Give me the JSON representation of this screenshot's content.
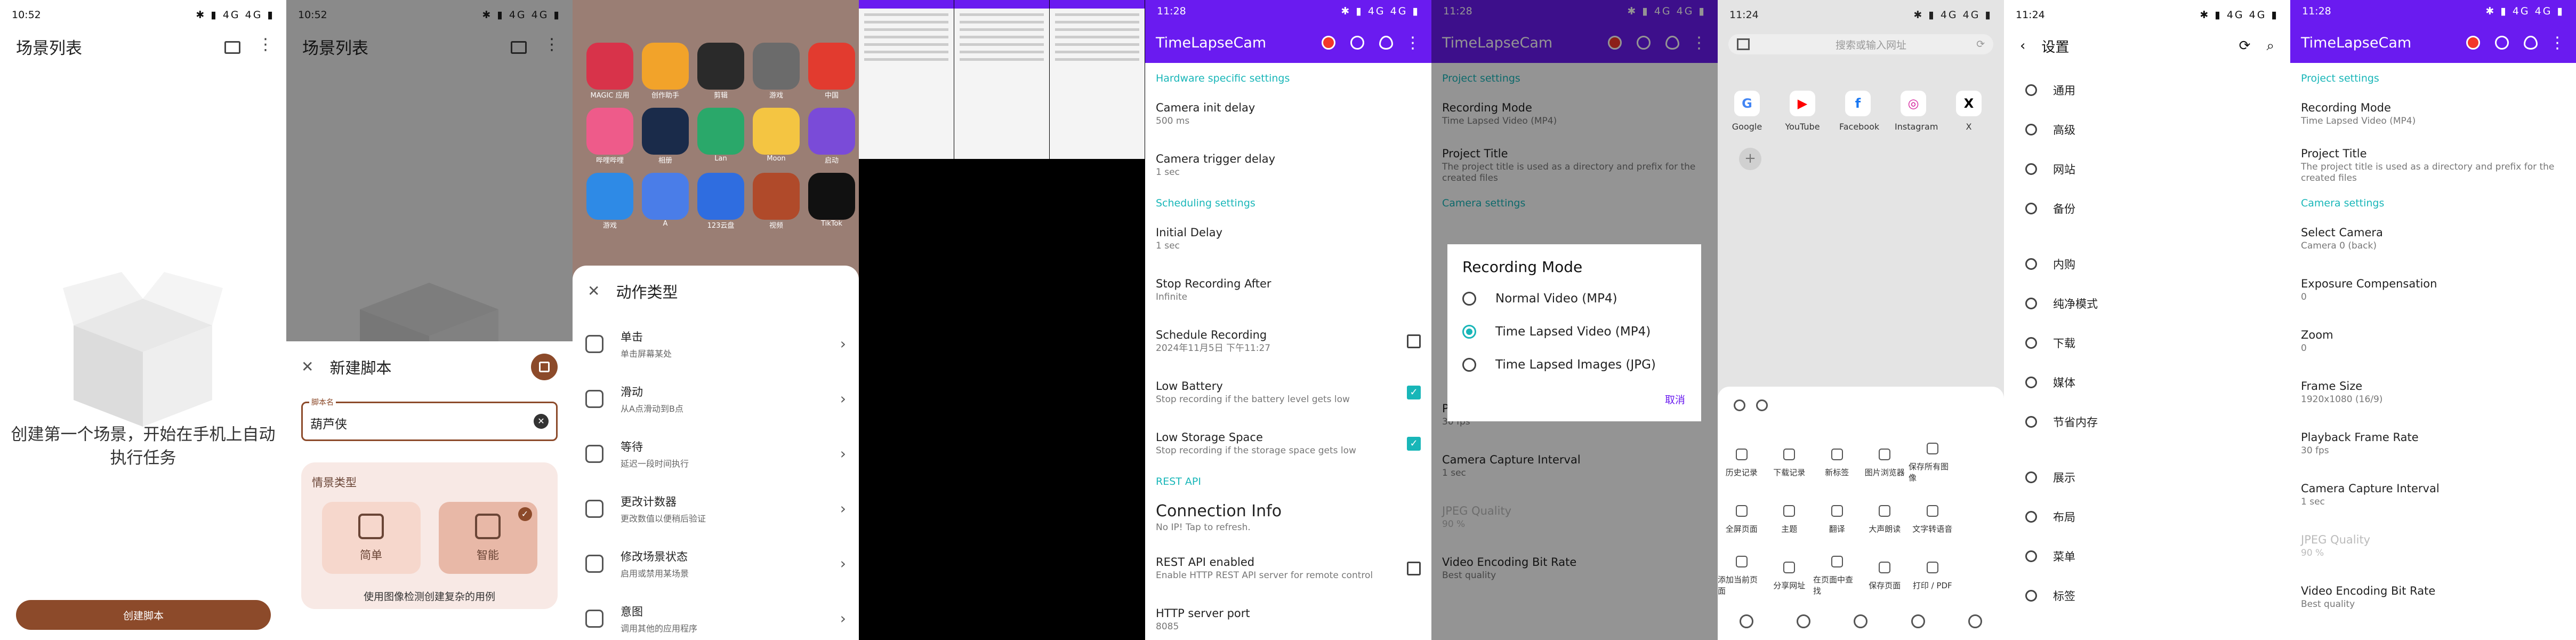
{
  "panel1": {
    "time": "10:52",
    "status_icons": "✱ ▮ 4G 4G ▮",
    "title": "场景列表",
    "empty_text": "创建第一个场景，开始在手机上自动执行任务",
    "create_button": "创建脚本"
  },
  "panel2": {
    "time": "10:52",
    "title": "场景列表",
    "sheet_title": "新建脚本",
    "field_label": "脚本名",
    "field_value": "葫芦侠",
    "scene_label": "情景类型",
    "simple": "简单",
    "smart": "智能",
    "note": "使用图像检测创建复杂的用例"
  },
  "panel3": {
    "apps": [
      "MAGIC 应用",
      "创作助手",
      "剪辑",
      "游戏",
      "中国",
      "哔哩哔哩",
      "相册",
      "Lan",
      "Moon",
      "启动",
      "游戏",
      "A",
      "123云盘",
      "视频",
      "TikTok"
    ],
    "sheet_title": "动作类型",
    "actions": [
      {
        "name": "单击",
        "desc": "单击屏幕某处"
      },
      {
        "name": "滑动",
        "desc": "从A点滑动到B点"
      },
      {
        "name": "等待",
        "desc": "延迟一段时间执行"
      },
      {
        "name": "更改计数器",
        "desc": "更改数值以便稍后验证"
      },
      {
        "name": "修改场景状态",
        "desc": "启用或禁用某场景"
      },
      {
        "name": "意图",
        "desc": "调用其他的应用程序"
      }
    ]
  },
  "tlc": {
    "time": "11:28",
    "app_title": "TimeLapseCam"
  },
  "panel5": {
    "sections": [
      {
        "header": "Hardware specific settings",
        "rows": [
          {
            "name": "Camera init delay",
            "desc": "500 ms"
          },
          {
            "name": "Camera trigger delay",
            "desc": "1 sec"
          }
        ]
      },
      {
        "header": "Scheduling settings",
        "rows": [
          {
            "name": "Initial Delay",
            "desc": "1 sec"
          },
          {
            "name": "Stop Recording After",
            "desc": "Infinite"
          },
          {
            "name": "Schedule Recording",
            "desc": "2024年11月5日 下午11:27",
            "check": "off"
          },
          {
            "name": "Low Battery",
            "desc": "Stop recording if the battery level gets low",
            "check": "on"
          },
          {
            "name": "Low Storage Space",
            "desc": "Stop recording if the storage space gets low",
            "check": "on"
          }
        ]
      },
      {
        "header": "REST API",
        "rows": [
          {
            "name": "Connection Info",
            "desc": "No IP! Tap to refresh.",
            "big": true
          },
          {
            "name": "REST API enabled",
            "desc": "Enable HTTP REST API server for remote control",
            "check": "off"
          },
          {
            "name": "HTTP server port",
            "desc": "8085"
          }
        ]
      }
    ]
  },
  "panel6": {
    "dialog_title": "Recording Mode",
    "options": [
      "Normal Video (MP4)",
      "Time Lapsed Video (MP4)",
      "Time Lapsed Images (JPG)"
    ],
    "selected": 1,
    "cancel": "取消",
    "lower_rows": [
      {
        "name": "Playback Frame Rate",
        "desc": "30 fps"
      },
      {
        "name": "Camera Capture Interval",
        "desc": "1 sec"
      },
      {
        "name": "JPEG Quality",
        "desc": "90 %"
      },
      {
        "name": "Video Encoding Bit Rate",
        "desc": "Best quality"
      }
    ]
  },
  "panel7": {
    "time": "11:24",
    "url_placeholder": "搜索或输入网址",
    "sites": [
      "Google",
      "YouTube",
      "Facebook",
      "Instagram",
      "X"
    ],
    "menu_items": [
      "历史记录",
      "下载记录",
      "新标签",
      "图片浏览器",
      "保存所有图像",
      "全屏页面",
      "主题",
      "翻译",
      "大声朗读",
      "文字转语音",
      "添加当前页面",
      "分享网址",
      "在页面中查找",
      "保存页面",
      "打印 / PDF"
    ]
  },
  "panel8": {
    "time": "11:24",
    "title": "设置",
    "items": [
      "通用",
      "高级",
      "网站",
      "备份",
      "",
      "内购",
      "纯净模式",
      "下载",
      "媒体",
      "节省内存",
      "",
      "展示",
      "布局",
      "菜单",
      "标签"
    ]
  },
  "panel9": {
    "sections": [
      {
        "header": "Project settings",
        "rows": [
          {
            "name": "Recording Mode",
            "desc": "Time Lapsed Video (MP4)"
          },
          {
            "name": "Project Title",
            "desc": "The project title is used as a directory and prefix for the created files"
          }
        ]
      },
      {
        "header": "Camera settings",
        "rows": [
          {
            "name": "Select Camera",
            "desc": "Camera 0 (back)"
          },
          {
            "name": "Exposure Compensation",
            "desc": "0"
          },
          {
            "name": "Zoom",
            "desc": "0"
          },
          {
            "name": "Frame Size",
            "desc": "1920x1080 (16/9)"
          },
          {
            "name": "Playback Frame Rate",
            "desc": "30 fps"
          },
          {
            "name": "Camera Capture Interval",
            "desc": "1 sec"
          },
          {
            "name": "JPEG Quality",
            "desc": "90 %",
            "disabled": true
          },
          {
            "name": "Video Encoding Bit Rate",
            "desc": "Best quality"
          }
        ]
      }
    ]
  },
  "colors": {
    "accent_purple": "#6a1bf0",
    "teal": "#18b6b8",
    "brown": "#8c4a2a"
  }
}
